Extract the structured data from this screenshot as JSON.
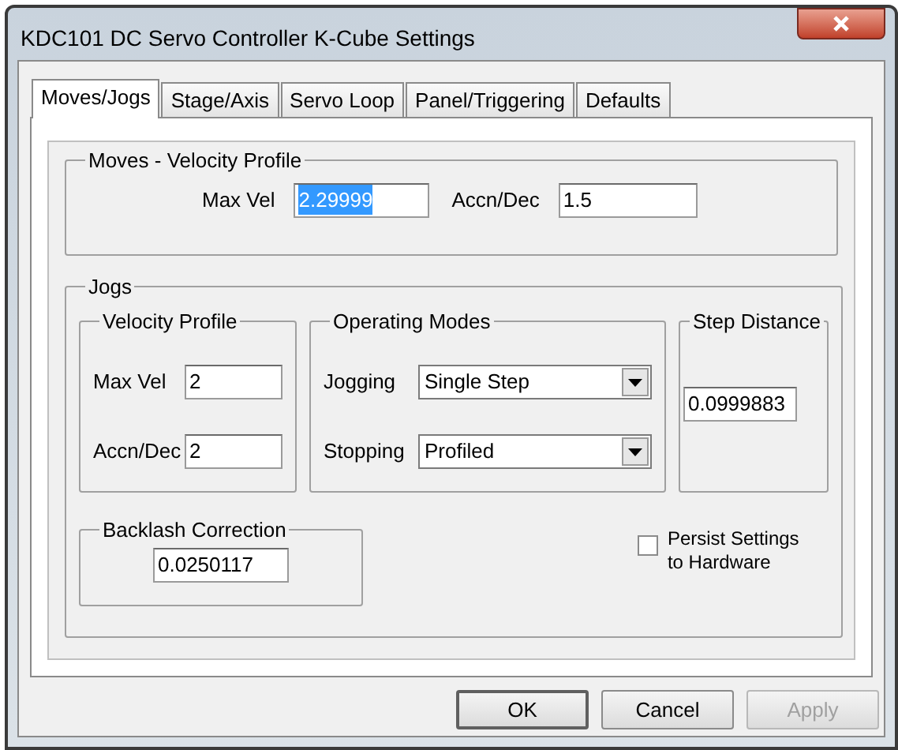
{
  "window": {
    "title": "KDC101 DC Servo Controller K-Cube Settings"
  },
  "tabs": [
    {
      "label": "Moves/Jogs",
      "selected": true
    },
    {
      "label": "Stage/Axis",
      "selected": false
    },
    {
      "label": "Servo Loop",
      "selected": false
    },
    {
      "label": "Panel/Triggering",
      "selected": false
    },
    {
      "label": "Defaults",
      "selected": false
    }
  ],
  "moves": {
    "title": "Moves - Velocity Profile",
    "fields": [
      {
        "label": "Max Vel",
        "value": "2.29999",
        "text_selected": true
      },
      {
        "label": "Accn/Dec",
        "value": "1.5",
        "text_selected": false
      }
    ]
  },
  "jogs": {
    "title": "Jogs",
    "velocity_profile": {
      "title": "Velocity Profile",
      "fields": [
        {
          "label": "Max Vel",
          "value": "2"
        },
        {
          "label": "Accn/Dec",
          "value": "2"
        }
      ]
    },
    "operating_modes": {
      "title": "Operating Modes",
      "dropdowns": [
        {
          "label": "Jogging",
          "value": "Single Step"
        },
        {
          "label": "Stopping",
          "value": "Profiled"
        }
      ]
    },
    "step_distance": {
      "title": "Step Distance",
      "value": "0.0999883"
    },
    "backlash": {
      "title": "Backlash Correction",
      "value": "0.0250117"
    },
    "persist": {
      "label": "Persist Settings to Hardware",
      "checked": false
    }
  },
  "buttons": [
    {
      "label": "OK",
      "default": true,
      "disabled": false
    },
    {
      "label": "Cancel",
      "default": false,
      "disabled": false
    },
    {
      "label": "Apply",
      "default": false,
      "disabled": true
    }
  ]
}
